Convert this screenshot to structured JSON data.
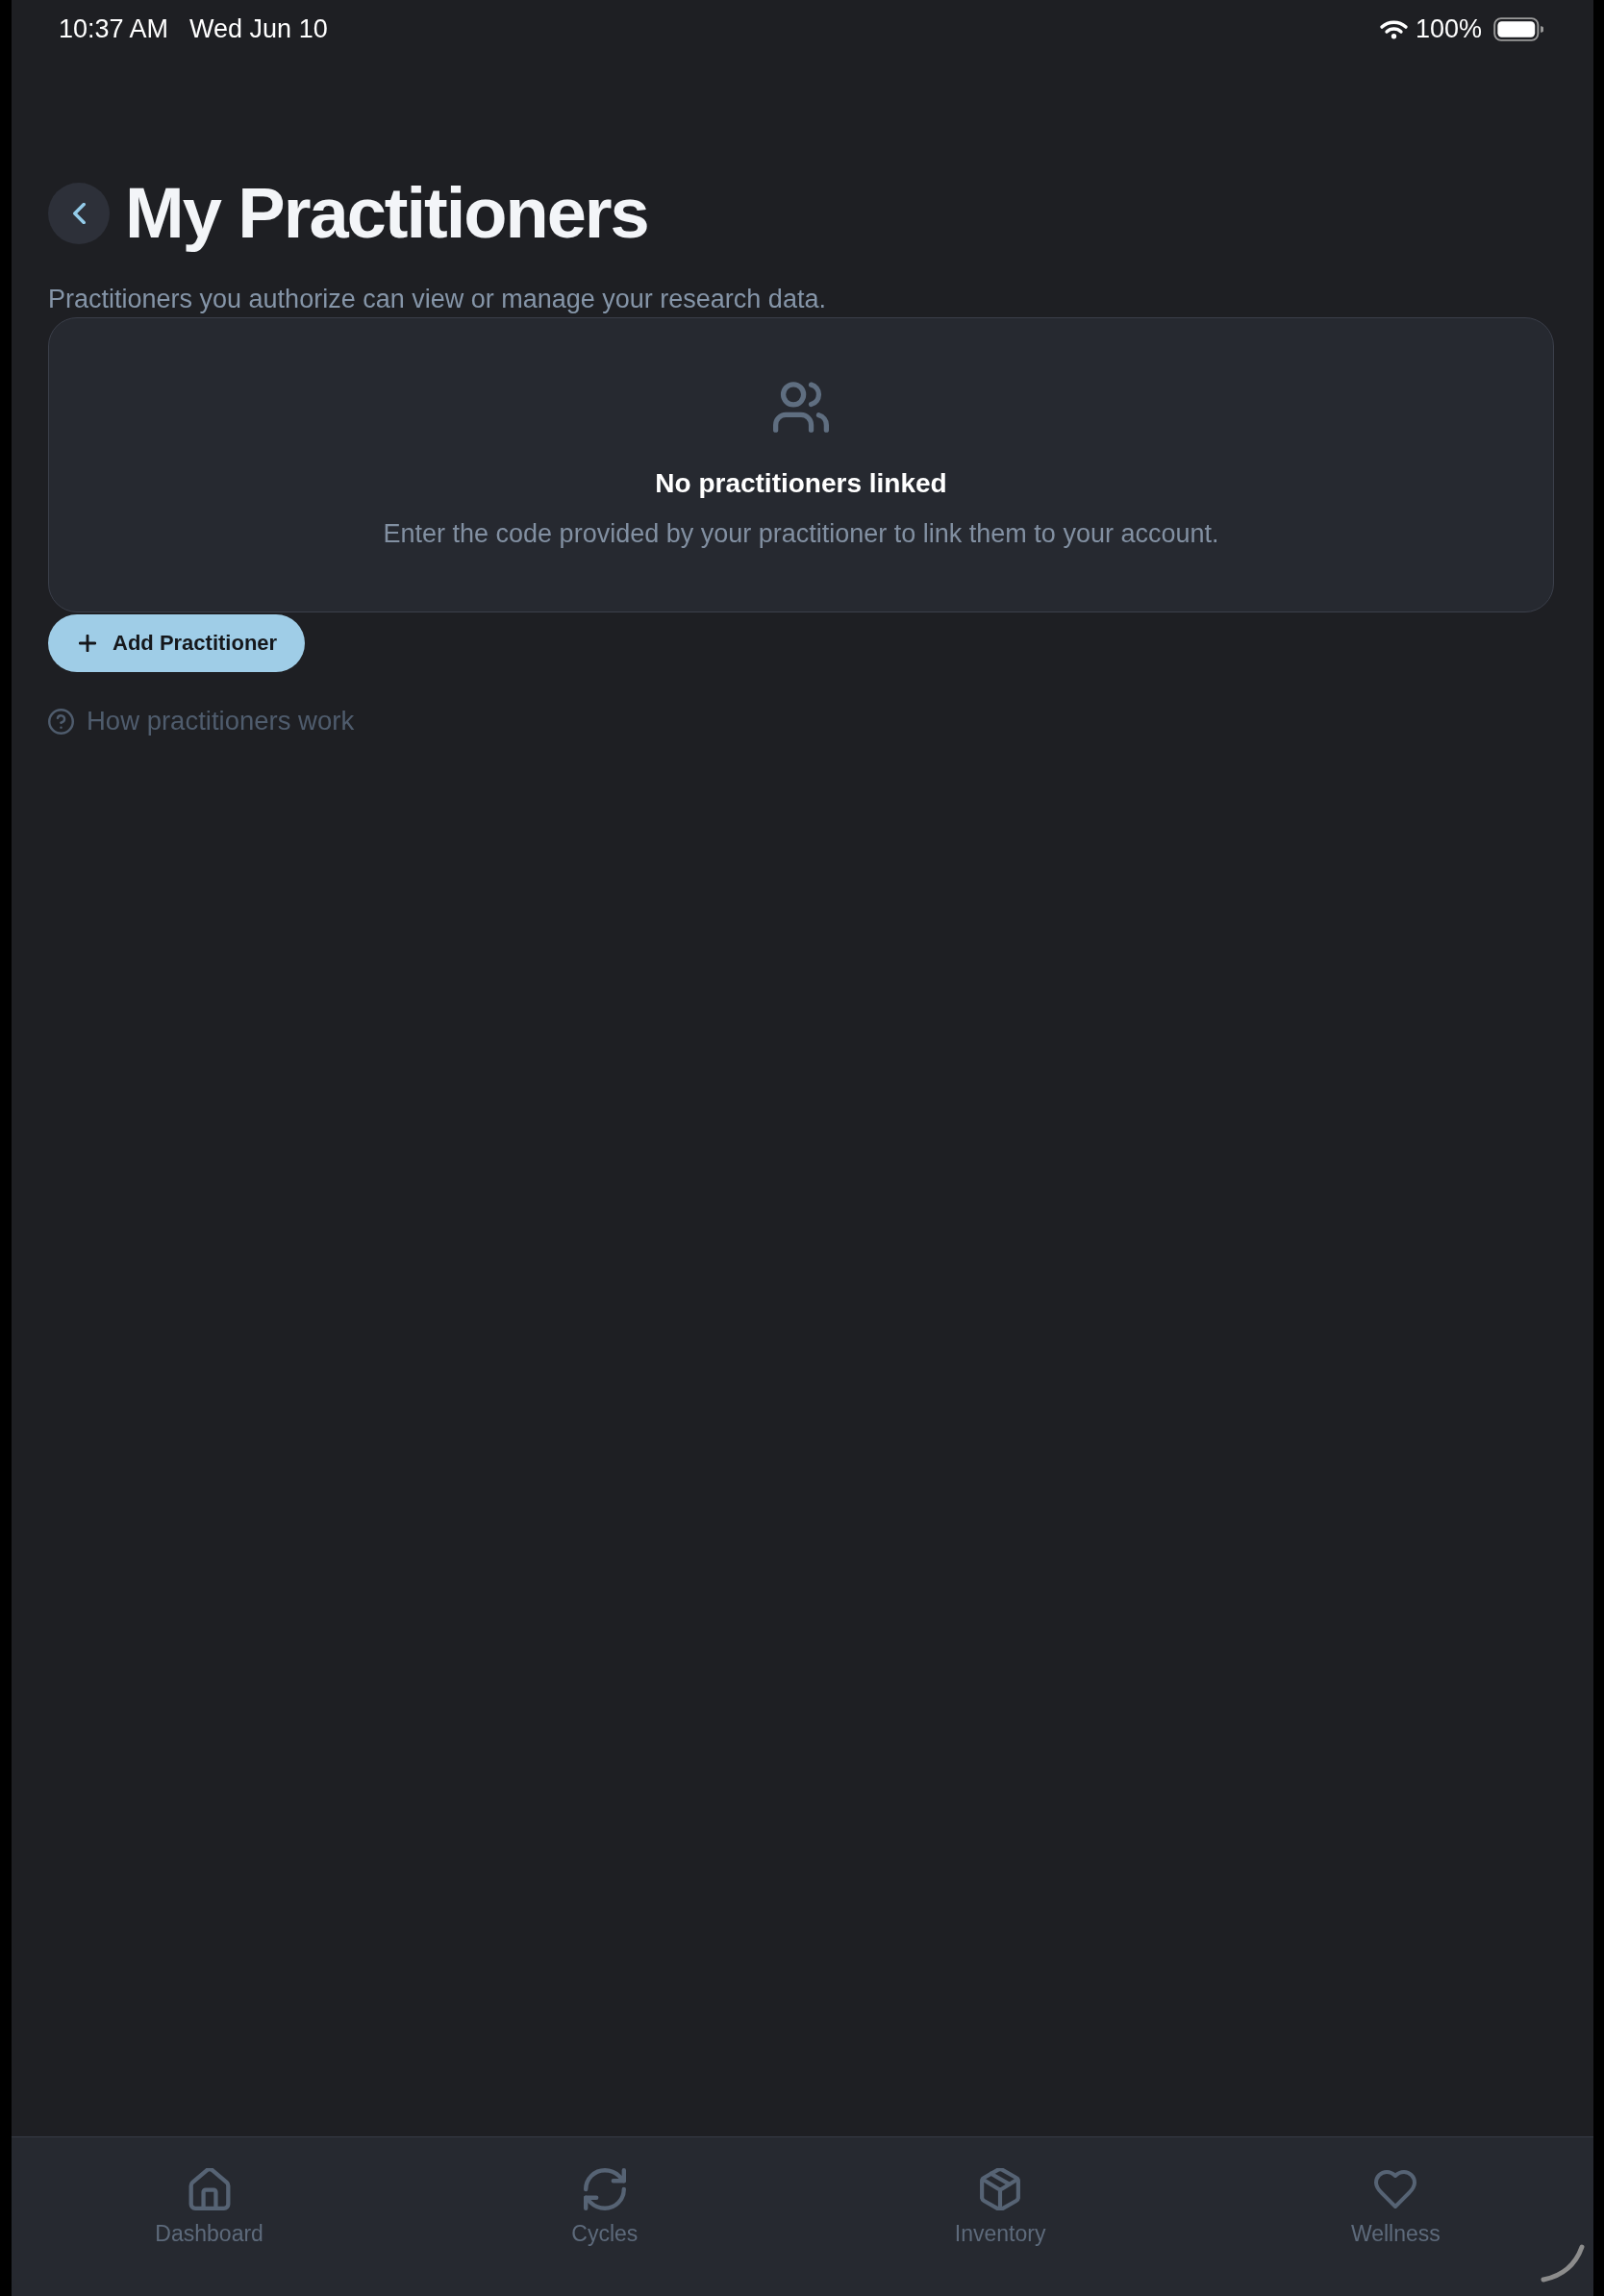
{
  "status_bar": {
    "time": "10:37 AM",
    "date": "Wed Jun 10",
    "battery": "100%"
  },
  "header": {
    "title": "My Practitioners",
    "subtitle": "Practitioners you authorize can view or manage your research data."
  },
  "empty_state": {
    "title": "No practitioners linked",
    "message": "Enter the code provided by your practitioner to link them to your account."
  },
  "add_button": {
    "label": "Add Practitioner"
  },
  "help_link": {
    "label": "How practitioners work"
  },
  "tab_bar": {
    "tabs": [
      {
        "label": "Dashboard",
        "kind": "home",
        "selected": false
      },
      {
        "label": "Cycles",
        "kind": "refresh",
        "selected": false
      },
      {
        "label": "Inventory",
        "kind": "box",
        "selected": false
      },
      {
        "label": "Wellness",
        "kind": "heart",
        "selected": false
      }
    ]
  }
}
